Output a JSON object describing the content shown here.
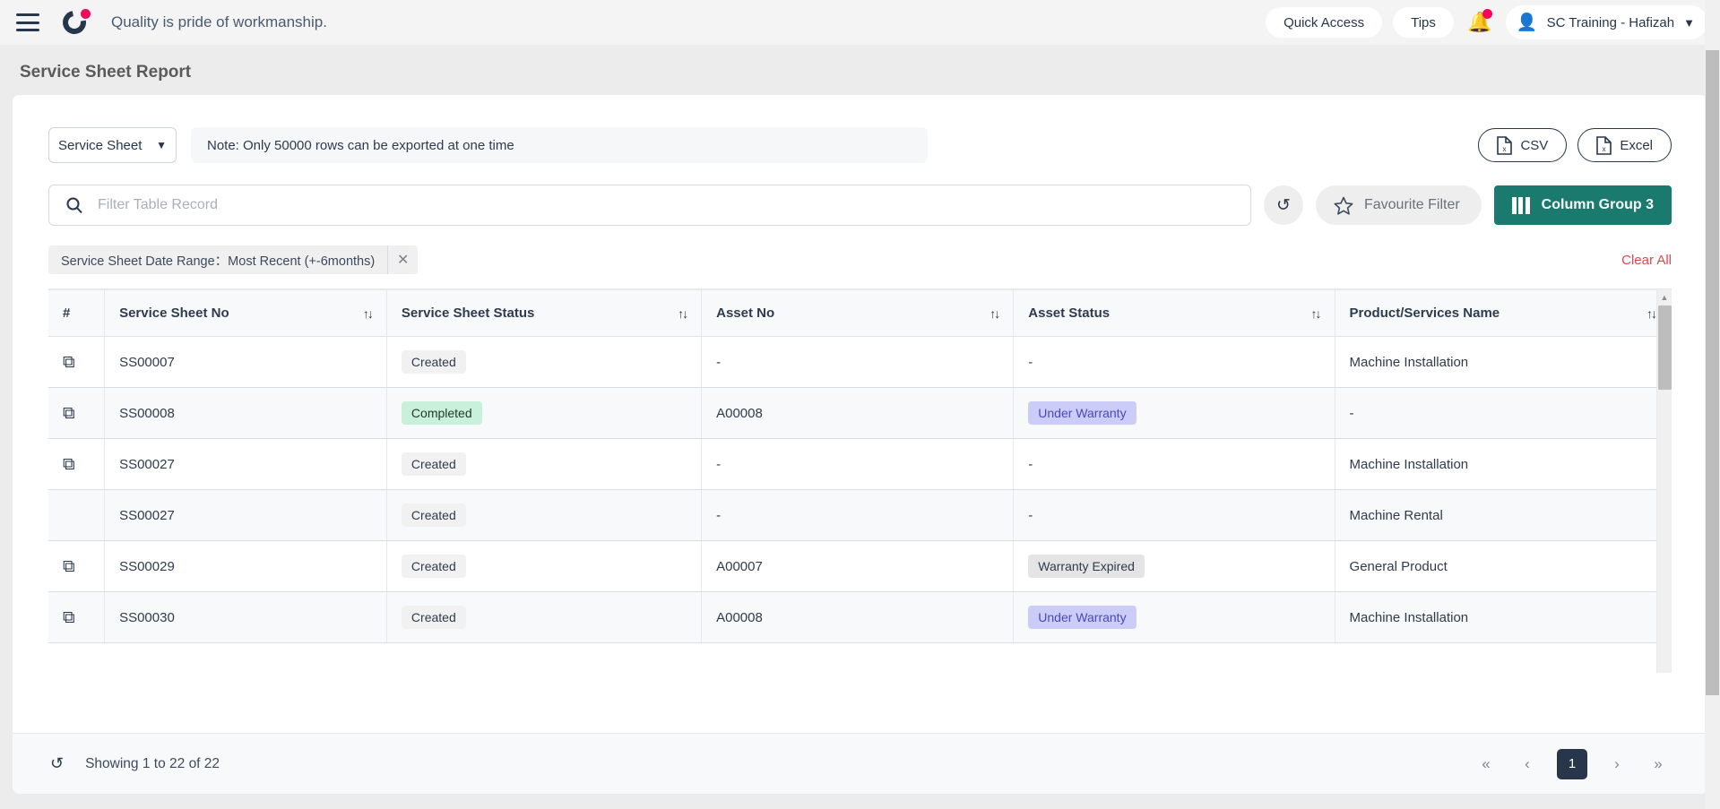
{
  "topbar": {
    "menu_icon": "hamburger-icon",
    "logo_icon": "brand-logo",
    "tagline": "Quality is pride of workmanship.",
    "quick_access": "Quick Access",
    "tips": "Tips",
    "notification_icon": "bell-icon",
    "user_name": "SC Training - Hafizah",
    "user_icon": "person-icon",
    "chevron": "⌄"
  },
  "page": {
    "title": "Service Sheet Report"
  },
  "export": {
    "select_value": "Service Sheet",
    "select_chevron": "⌄",
    "note": "Note: Only 50000 rows can be exported at one time",
    "csv_label": "CSV",
    "excel_label": "Excel",
    "file_icon": "file-excel-icon"
  },
  "search": {
    "placeholder": "Filter Table Record",
    "value": "",
    "search_icon": "search-icon",
    "refresh_icon": "↺",
    "favourite_label": "Favourite Filter",
    "favourite_icon": "star-icon",
    "column_group_label": "Column Group 3",
    "column_group_icon": "columns-icon"
  },
  "filters": {
    "chip_label": "Service Sheet Date Range：Most Recent (+-6months)",
    "chip_close": "✕",
    "clear_all": "Clear All"
  },
  "table": {
    "columns": [
      {
        "label": "#",
        "sortable": false
      },
      {
        "label": "Service Sheet No",
        "sortable": true
      },
      {
        "label": "Service Sheet Status",
        "sortable": true
      },
      {
        "label": "Asset No",
        "sortable": true
      },
      {
        "label": "Asset Status",
        "sortable": true
      },
      {
        "label": "Product/Services Name",
        "sortable": true
      }
    ],
    "sort_icon": "↑↓",
    "open_icon": "⧉",
    "rows": [
      {
        "open": true,
        "sheet_no": "SS00007",
        "status": "Created",
        "status_kind": "grey",
        "asset_no": "-",
        "asset_status": "-",
        "asset_status_kind": "none",
        "product": "Machine Installation"
      },
      {
        "open": true,
        "sheet_no": "SS00008",
        "status": "Completed",
        "status_kind": "green",
        "asset_no": "A00008",
        "asset_status": "Under Warranty",
        "asset_status_kind": "purple",
        "product": "-"
      },
      {
        "open": true,
        "sheet_no": "SS00027",
        "status": "Created",
        "status_kind": "grey",
        "asset_no": "-",
        "asset_status": "-",
        "asset_status_kind": "none",
        "product": "Machine Installation"
      },
      {
        "open": false,
        "sheet_no": "SS00027",
        "status": "Created",
        "status_kind": "grey",
        "asset_no": "-",
        "asset_status": "-",
        "asset_status_kind": "none",
        "product": "Machine Rental"
      },
      {
        "open": true,
        "sheet_no": "SS00029",
        "status": "Created",
        "status_kind": "grey",
        "asset_no": "A00007",
        "asset_status": "Warranty Expired",
        "asset_status_kind": "grey2",
        "product": "General Product"
      },
      {
        "open": true,
        "sheet_no": "SS00030",
        "status": "Created",
        "status_kind": "grey",
        "asset_no": "A00008",
        "asset_status": "Under Warranty",
        "asset_status_kind": "purple",
        "product": "Machine Installation"
      }
    ]
  },
  "footer": {
    "refresh_icon": "↺",
    "showing": "Showing 1 to 22 of 22",
    "first": "«",
    "prev": "‹",
    "current_page": "1",
    "next": "›",
    "last": "»"
  },
  "colors": {
    "accent_teal": "#1a7a6d",
    "navy": "#27364b",
    "pink": "#f5055c",
    "danger": "#e2474b"
  }
}
